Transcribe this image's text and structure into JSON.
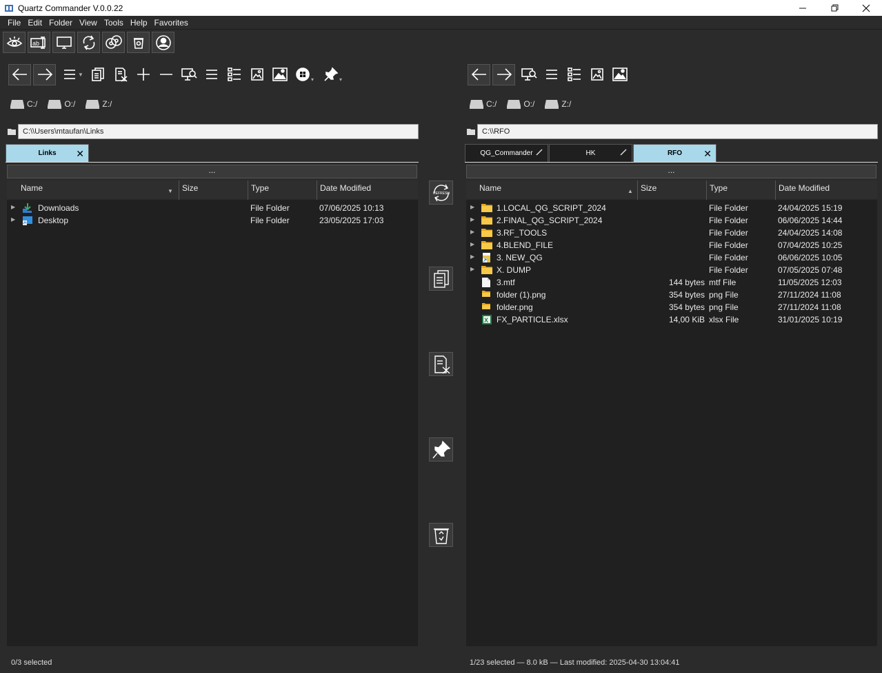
{
  "window": {
    "title": "Quartz Commander V.0.0.22"
  },
  "menu": [
    "File",
    "Edit",
    "Folder",
    "View",
    "Tools",
    "Help",
    "Favorites"
  ],
  "top_icons": [
    "eye-icon",
    "rename-icon",
    "monitor-icon",
    "sync-icon",
    "disks-icon",
    "trash-small-icon",
    "user-icon"
  ],
  "left": {
    "drives": [
      "C:/",
      "O:/",
      "Z:/"
    ],
    "path": "C:\\\\Users\\mtaufan\\Links",
    "tabs": [
      {
        "label": "Links",
        "active": true
      }
    ],
    "ellipsis": "...",
    "columns": {
      "name": "Name",
      "size": "Size",
      "type": "Type",
      "date": "Date Modified"
    },
    "rows": [
      {
        "name": "Downloads",
        "size": "",
        "type": "File Folder",
        "date": "07/06/2025 10:13",
        "icon": "downloads-icon",
        "expandable": true
      },
      {
        "name": "Desktop",
        "size": "",
        "type": "File Folder",
        "date": "23/05/2025 17:03",
        "icon": "desktop-icon",
        "expandable": true
      }
    ],
    "status": "0/3 selected"
  },
  "right": {
    "drives": [
      "C:/",
      "O:/",
      "Z:/"
    ],
    "path": "C:\\\\RFO",
    "tabs": [
      {
        "label": "QG_Commander",
        "active": false
      },
      {
        "label": "HK",
        "active": false
      },
      {
        "label": "RFO",
        "active": true
      }
    ],
    "ellipsis": "...",
    "columns": {
      "name": "Name",
      "size": "Size",
      "type": "Type",
      "date": "Date Modified"
    },
    "rows": [
      {
        "name": "1.LOCAL_QG_SCRIPT_2024",
        "size": "",
        "type": "File Folder",
        "date": "24/04/2025 15:19",
        "icon": "folder-icon",
        "expandable": true
      },
      {
        "name": "2.FINAL_QG_SCRIPT_2024",
        "size": "",
        "type": "File Folder",
        "date": "06/06/2025 14:44",
        "icon": "folder-icon",
        "expandable": true
      },
      {
        "name": "3.RF_TOOLS",
        "size": "",
        "type": "File Folder",
        "date": "24/04/2025 14:08",
        "icon": "folder-icon",
        "expandable": true
      },
      {
        "name": "4.BLEND_FILE",
        "size": "",
        "type": "File Folder",
        "date": "07/04/2025 10:25",
        "icon": "folder-icon",
        "expandable": true
      },
      {
        "name": "3. NEW_QG",
        "size": "",
        "type": "File Folder",
        "date": "06/06/2025 10:05",
        "icon": "folder-shortcut-icon",
        "expandable": true
      },
      {
        "name": "X. DUMP",
        "size": "",
        "type": "File Folder",
        "date": "07/05/2025 07:48",
        "icon": "folder-icon",
        "expandable": true
      },
      {
        "name": "3.mtf",
        "size": "144 bytes",
        "type": "mtf File",
        "date": "11/05/2025 12:03",
        "icon": "file-icon",
        "expandable": false
      },
      {
        "name": "folder (1).png",
        "size": "354 bytes",
        "type": "png File",
        "date": "27/11/2024 11:08",
        "icon": "png-folder-icon",
        "expandable": false
      },
      {
        "name": "folder.png",
        "size": "354 bytes",
        "type": "png File",
        "date": "27/11/2024 11:08",
        "icon": "png-folder-icon",
        "expandable": false
      },
      {
        "name": "FX_PARTICLE.xlsx",
        "size": "14,00 KiB",
        "type": "xlsx File",
        "date": "31/01/2025 10:19",
        "icon": "excel-icon",
        "expandable": false
      }
    ],
    "status": "1/23 selected — 8.0 kB — Last modified: 2025-04-30 13:04:41"
  },
  "middle": {
    "refresh_label": "REFRESH"
  }
}
